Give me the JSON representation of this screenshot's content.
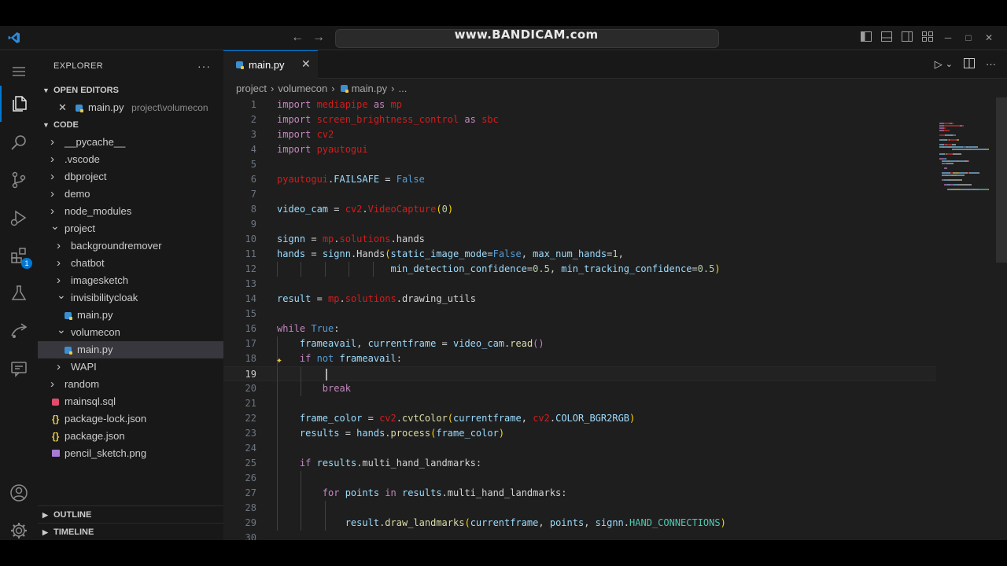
{
  "titlebar": {
    "watermark": "www.BANDICAM.com",
    "back_glyph": "←",
    "forward_glyph": "→",
    "layout_icons": [
      "layout-sidebar-left-icon",
      "layout-panel-icon",
      "layout-sidebar-right-icon",
      "customize-layout-icon"
    ],
    "window_controls": {
      "minimize": "─",
      "maximize": "□",
      "close": "✕"
    }
  },
  "activity_bar": {
    "items": [
      "explorer-icon",
      "search-icon",
      "source-control-icon",
      "run-debug-icon",
      "extensions-icon",
      "testing-icon",
      "remote-explorer-icon",
      "chat-icon"
    ],
    "extensions_badge": "1",
    "bottom_items": [
      "accounts-icon",
      "manage-gear-icon"
    ]
  },
  "sidebar": {
    "title": "EXPLORER",
    "more_glyph": "···",
    "open_editors": {
      "label": "OPEN EDITORS",
      "items": [
        {
          "name": "main.py",
          "path": "project\\volumecon"
        }
      ]
    },
    "folder": {
      "label": "CODE",
      "tree": [
        {
          "name": "__pycache__",
          "kind": "folder",
          "depth": 1,
          "open": false
        },
        {
          "name": ".vscode",
          "kind": "folder",
          "depth": 1,
          "open": false
        },
        {
          "name": "dbproject",
          "kind": "folder",
          "depth": 1,
          "open": false
        },
        {
          "name": "demo",
          "kind": "folder",
          "depth": 1,
          "open": false
        },
        {
          "name": "node_modules",
          "kind": "folder",
          "depth": 1,
          "open": false
        },
        {
          "name": "project",
          "kind": "folder",
          "depth": 1,
          "open": true
        },
        {
          "name": "backgroundremover",
          "kind": "folder",
          "depth": 2,
          "open": false
        },
        {
          "name": "chatbot",
          "kind": "folder",
          "depth": 2,
          "open": false
        },
        {
          "name": "imagesketch",
          "kind": "folder",
          "depth": 2,
          "open": false
        },
        {
          "name": "invisibilitycloak",
          "kind": "folder",
          "depth": 2,
          "open": true
        },
        {
          "name": "main.py",
          "kind": "py",
          "depth": 3
        },
        {
          "name": "volumecon",
          "kind": "folder",
          "depth": 2,
          "open": true
        },
        {
          "name": "main.py",
          "kind": "py",
          "depth": 3,
          "selected": true
        },
        {
          "name": "WAPI",
          "kind": "folder",
          "depth": 2,
          "open": false
        },
        {
          "name": "random",
          "kind": "folder",
          "depth": 1,
          "open": false
        },
        {
          "name": "mainsql.sql",
          "kind": "sql",
          "depth": 1
        },
        {
          "name": "package-lock.json",
          "kind": "json",
          "depth": 1
        },
        {
          "name": "package.json",
          "kind": "json",
          "depth": 1
        },
        {
          "name": "pencil_sketch.png",
          "kind": "png",
          "depth": 1
        }
      ]
    },
    "outline_label": "OUTLINE",
    "timeline_label": "TIMELINE"
  },
  "editor": {
    "tab_label": "main.py",
    "tab_close": "✕",
    "breadcrumb": [
      "project",
      "volumecon",
      "main.py",
      "..."
    ],
    "actions": {
      "run": "▷",
      "run_dropdown": "⌄",
      "split": "split-editor-icon",
      "more": "···"
    },
    "current_line": 19,
    "lines": [
      {
        "n": "1",
        "tokens": [
          [
            "k",
            "import "
          ],
          [
            "m",
            "mediapipe"
          ],
          [
            "k",
            " as "
          ],
          [
            "m",
            "mp"
          ]
        ]
      },
      {
        "n": "2",
        "tokens": [
          [
            "k",
            "import "
          ],
          [
            "m",
            "screen_brightness_control"
          ],
          [
            "k",
            " as "
          ],
          [
            "m",
            "sbc"
          ]
        ]
      },
      {
        "n": "3",
        "tokens": [
          [
            "k",
            "import "
          ],
          [
            "m",
            "cv2"
          ]
        ]
      },
      {
        "n": "4",
        "tokens": [
          [
            "k",
            "import "
          ],
          [
            "m",
            "pyautogui"
          ]
        ]
      },
      {
        "n": "5",
        "tokens": []
      },
      {
        "n": "6",
        "tokens": [
          [
            "m",
            "pyautogui"
          ],
          [
            "w",
            "."
          ],
          [
            "v",
            "FAILSAFE"
          ],
          [
            "o",
            " = "
          ],
          [
            "b",
            "False"
          ]
        ]
      },
      {
        "n": "7",
        "tokens": []
      },
      {
        "n": "8",
        "tokens": [
          [
            "v",
            "video_cam"
          ],
          [
            "o",
            " = "
          ],
          [
            "m",
            "cv2"
          ],
          [
            "w",
            "."
          ],
          [
            "m",
            "VideoCapture"
          ],
          [
            "y",
            "("
          ],
          [
            "n",
            "0"
          ],
          [
            "y",
            ")"
          ]
        ]
      },
      {
        "n": "9",
        "tokens": []
      },
      {
        "n": "10",
        "tokens": [
          [
            "v",
            "signn"
          ],
          [
            "o",
            " = "
          ],
          [
            "m",
            "mp"
          ],
          [
            "w",
            "."
          ],
          [
            "m",
            "solutions"
          ],
          [
            "w",
            "."
          ],
          [
            "w",
            "hands"
          ]
        ]
      },
      {
        "n": "11",
        "tokens": [
          [
            "v",
            "hands"
          ],
          [
            "o",
            " = "
          ],
          [
            "v",
            "signn"
          ],
          [
            "w",
            "."
          ],
          [
            "w",
            "Hands"
          ],
          [
            "y",
            "("
          ],
          [
            "v",
            "static_image_mode"
          ],
          [
            "o",
            "="
          ],
          [
            "b",
            "False"
          ],
          [
            "w",
            ", "
          ],
          [
            "v",
            "max_num_hands"
          ],
          [
            "o",
            "="
          ],
          [
            "n",
            "1"
          ],
          [
            "w",
            ","
          ]
        ]
      },
      {
        "n": "12",
        "indent": "                    ",
        "guides": 5,
        "tokens": [
          [
            "v",
            "min_detection_confidence"
          ],
          [
            "o",
            "="
          ],
          [
            "n",
            "0.5"
          ],
          [
            "w",
            ", "
          ],
          [
            "v",
            "min_tracking_confidence"
          ],
          [
            "o",
            "="
          ],
          [
            "n",
            "0.5"
          ],
          [
            "y",
            ")"
          ]
        ]
      },
      {
        "n": "13",
        "tokens": []
      },
      {
        "n": "14",
        "tokens": [
          [
            "v",
            "result"
          ],
          [
            "o",
            " = "
          ],
          [
            "m",
            "mp"
          ],
          [
            "w",
            "."
          ],
          [
            "m",
            "solutions"
          ],
          [
            "w",
            "."
          ],
          [
            "w",
            "drawing_utils"
          ]
        ]
      },
      {
        "n": "15",
        "tokens": []
      },
      {
        "n": "16",
        "tokens": [
          [
            "k",
            "while "
          ],
          [
            "b",
            "True"
          ],
          [
            "w",
            ":"
          ]
        ]
      },
      {
        "n": "17",
        "indent": "    ",
        "guides": 1,
        "tokens": [
          [
            "v",
            "frameavail"
          ],
          [
            "w",
            ", "
          ],
          [
            "v",
            "currentframe"
          ],
          [
            "o",
            " = "
          ],
          [
            "v",
            "video_cam"
          ],
          [
            "w",
            "."
          ],
          [
            "f",
            "read"
          ],
          [
            "p",
            "()"
          ]
        ]
      },
      {
        "n": "18",
        "indent": "    ",
        "guides": 1,
        "tokens": [
          [
            "k",
            "if "
          ],
          [
            "b",
            "not "
          ],
          [
            "v",
            "frameavail"
          ],
          [
            "w",
            ":"
          ]
        ]
      },
      {
        "n": "19",
        "indent": "        ",
        "guides": 2,
        "tokens": []
      },
      {
        "n": "20",
        "indent": "        ",
        "guides": 2,
        "tokens": [
          [
            "k",
            "break"
          ]
        ]
      },
      {
        "n": "21",
        "guides": 1,
        "tokens": []
      },
      {
        "n": "22",
        "indent": "    ",
        "guides": 1,
        "tokens": [
          [
            "v",
            "frame_color"
          ],
          [
            "o",
            " = "
          ],
          [
            "m",
            "cv2"
          ],
          [
            "w",
            "."
          ],
          [
            "f",
            "cvtColor"
          ],
          [
            "y",
            "("
          ],
          [
            "v",
            "currentframe"
          ],
          [
            "w",
            ", "
          ],
          [
            "m",
            "cv2"
          ],
          [
            "w",
            "."
          ],
          [
            "v",
            "COLOR_BGR2RGB"
          ],
          [
            "y",
            ")"
          ]
        ]
      },
      {
        "n": "23",
        "indent": "    ",
        "guides": 1,
        "tokens": [
          [
            "v",
            "results"
          ],
          [
            "o",
            " = "
          ],
          [
            "v",
            "hands"
          ],
          [
            "w",
            "."
          ],
          [
            "f",
            "process"
          ],
          [
            "y",
            "("
          ],
          [
            "v",
            "frame_color"
          ],
          [
            "y",
            ")"
          ]
        ]
      },
      {
        "n": "24",
        "guides": 1,
        "tokens": []
      },
      {
        "n": "25",
        "indent": "    ",
        "guides": 1,
        "tokens": [
          [
            "k",
            "if "
          ],
          [
            "v",
            "results"
          ],
          [
            "w",
            "."
          ],
          [
            "w",
            "multi_hand_landmarks"
          ],
          [
            "w",
            ":"
          ]
        ]
      },
      {
        "n": "26",
        "guides": 2,
        "tokens": []
      },
      {
        "n": "27",
        "indent": "        ",
        "guides": 2,
        "tokens": [
          [
            "k",
            "for "
          ],
          [
            "v",
            "points"
          ],
          [
            "k",
            " in "
          ],
          [
            "v",
            "results"
          ],
          [
            "w",
            "."
          ],
          [
            "w",
            "multi_hand_landmarks"
          ],
          [
            "w",
            ":"
          ]
        ]
      },
      {
        "n": "28",
        "guides": 3,
        "tokens": []
      },
      {
        "n": "29",
        "indent": "            ",
        "guides": 3,
        "tokens": [
          [
            "v",
            "result"
          ],
          [
            "w",
            "."
          ],
          [
            "f",
            "draw_landmarks"
          ],
          [
            "y",
            "("
          ],
          [
            "v",
            "currentframe"
          ],
          [
            "w",
            ", "
          ],
          [
            "v",
            "points"
          ],
          [
            "w",
            ", "
          ],
          [
            "v",
            "signn"
          ],
          [
            "w",
            "."
          ],
          [
            "c",
            "HAND_CONNECTIONS"
          ],
          [
            "y",
            ")"
          ]
        ]
      },
      {
        "n": "30",
        "tokens": []
      }
    ]
  }
}
